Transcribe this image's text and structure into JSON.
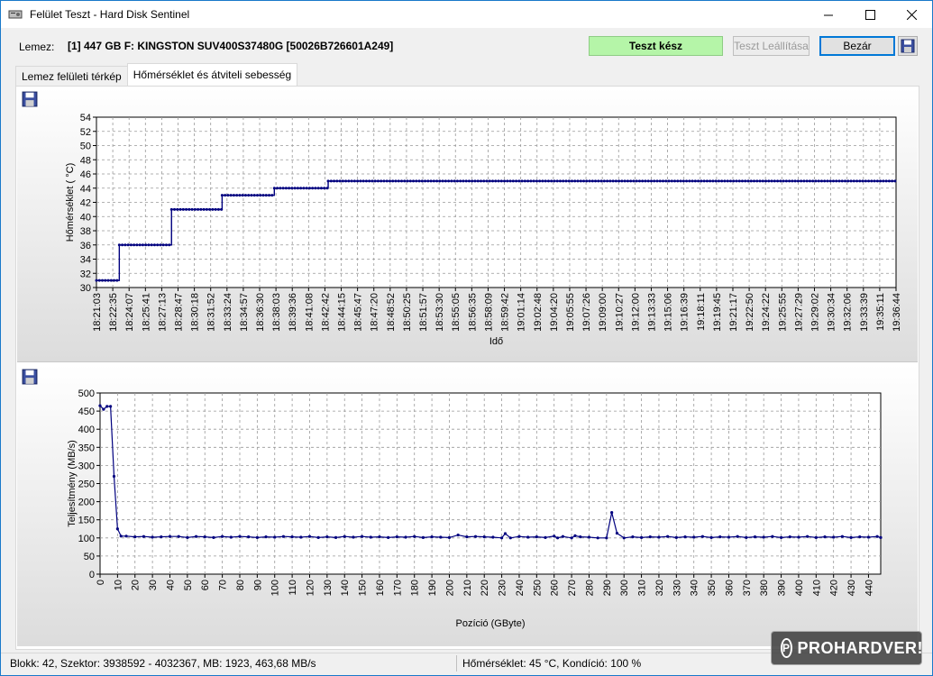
{
  "window": {
    "title": "Felület Teszt - Hard Disk Sentinel",
    "controls": [
      "minimize",
      "maximize",
      "close"
    ]
  },
  "toprow": {
    "lemez_label": "Lemez:",
    "lemez_value": "[1] 447 GB F: KINGSTON SUV400S37480G [50026B726601A249]",
    "status": "Teszt kész",
    "status_color": "#b5f5a8",
    "stop_button": "Teszt Leállítása",
    "close_button": "Bezár"
  },
  "tabs": [
    {
      "label": "Lemez felületi térkép",
      "active": false
    },
    {
      "label": "Hőmérséklet és átviteli sebesség",
      "active": true
    }
  ],
  "chart_data": [
    {
      "type": "line",
      "title": "",
      "xlabel": "Idő",
      "ylabel": "Hőmérséklet ( °C)",
      "ylim": [
        30,
        54
      ],
      "yticks": [
        30,
        32,
        34,
        36,
        38,
        40,
        42,
        44,
        46,
        48,
        50,
        52,
        54
      ],
      "grid": true,
      "xticks": [
        "18:21:03",
        "18:22:35",
        "18:24:07",
        "18:25:41",
        "18:27:13",
        "18:28:47",
        "18:30:18",
        "18:31:52",
        "18:33:24",
        "18:34:57",
        "18:36:30",
        "18:38:03",
        "18:39:36",
        "18:41:08",
        "18:42:42",
        "18:44:15",
        "18:45:47",
        "18:47:20",
        "18:48:52",
        "18:50:25",
        "18:51:57",
        "18:53:30",
        "18:55:05",
        "18:56:35",
        "18:58:09",
        "18:59:42",
        "19:01:14",
        "19:02:48",
        "19:04:20",
        "19:05:55",
        "19:07:26",
        "19:09:00",
        "19:10:27",
        "19:12:00",
        "19:13:33",
        "19:15:06",
        "19:16:39",
        "19:18:11",
        "19:19:45",
        "19:21:17",
        "19:22:50",
        "19:24:22",
        "19:25:55",
        "19:27:29",
        "19:29:02",
        "19:30:34",
        "19:32:06",
        "19:33:39",
        "19:35:11",
        "19:36:44"
      ],
      "series": [
        {
          "steps": [
            {
              "from": 0,
              "to": 1.4,
              "value": 31
            },
            {
              "from": 1.4,
              "to": 4.6,
              "value": 36
            },
            {
              "from": 4.6,
              "to": 7.7,
              "value": 41
            },
            {
              "from": 7.7,
              "to": 10.9,
              "value": 43
            },
            {
              "from": 10.9,
              "to": 14.2,
              "value": 44
            },
            {
              "from": 14.2,
              "to": 49,
              "value": 45
            }
          ],
          "color": "#00007f"
        }
      ]
    },
    {
      "type": "line",
      "title": "",
      "xlabel": "Pozíció (GByte)",
      "ylabel": "Teljesítmény (MB/s)",
      "xlim": [
        0,
        447
      ],
      "ylim": [
        0,
        500
      ],
      "yticks": [
        0,
        50,
        100,
        150,
        200,
        250,
        300,
        350,
        400,
        450,
        500
      ],
      "xticks": [
        0,
        10,
        20,
        30,
        40,
        50,
        60,
        70,
        80,
        90,
        100,
        110,
        120,
        130,
        140,
        150,
        160,
        170,
        180,
        190,
        200,
        210,
        220,
        230,
        240,
        250,
        260,
        270,
        280,
        290,
        300,
        310,
        320,
        330,
        340,
        350,
        360,
        370,
        380,
        390,
        400,
        410,
        420,
        430,
        440
      ],
      "grid": true,
      "series": [
        {
          "color": "#00007f",
          "x": [
            0,
            2,
            4,
            6,
            8,
            10,
            12,
            15,
            20,
            25,
            30,
            35,
            40,
            45,
            50,
            55,
            60,
            65,
            70,
            75,
            80,
            85,
            90,
            95,
            100,
            105,
            110,
            115,
            120,
            125,
            130,
            135,
            140,
            145,
            150,
            155,
            160,
            165,
            170,
            175,
            180,
            185,
            190,
            195,
            200,
            205,
            210,
            215,
            220,
            225,
            230,
            232,
            235,
            240,
            245,
            250,
            255,
            260,
            262,
            265,
            270,
            272,
            275,
            280,
            285,
            290,
            293,
            296,
            300,
            305,
            310,
            315,
            320,
            325,
            330,
            335,
            340,
            345,
            350,
            355,
            360,
            365,
            370,
            375,
            380,
            385,
            390,
            395,
            400,
            405,
            410,
            415,
            420,
            425,
            430,
            435,
            440,
            445,
            447
          ],
          "y": [
            465,
            455,
            463,
            463,
            270,
            125,
            105,
            105,
            103,
            104,
            102,
            103,
            104,
            104,
            101,
            104,
            103,
            101,
            104,
            102,
            104,
            103,
            101,
            103,
            102,
            104,
            103,
            102,
            104,
            101,
            103,
            101,
            104,
            102,
            104,
            102,
            103,
            101,
            103,
            102,
            104,
            101,
            103,
            102,
            101,
            108,
            103,
            104,
            103,
            102,
            100,
            112,
            100,
            104,
            102,
            103,
            101,
            105,
            100,
            104,
            100,
            106,
            103,
            102,
            100,
            100,
            170,
            113,
            100,
            103,
            101,
            103,
            102,
            104,
            101,
            103,
            102,
            104,
            101,
            103,
            102,
            104,
            101,
            103,
            102,
            104,
            101,
            103,
            102,
            104,
            101,
            103,
            102,
            104,
            101,
            103,
            102,
            104,
            101
          ]
        }
      ]
    }
  ],
  "statusbar": {
    "left": "Blokk: 42, Szektor: 3938592 - 4032367, MB: 1923, 463,68 MB/s",
    "right": "Hőmérséklet: 45  °C,  Kondíció: 100 %"
  },
  "watermark": "PROHARDVER!"
}
